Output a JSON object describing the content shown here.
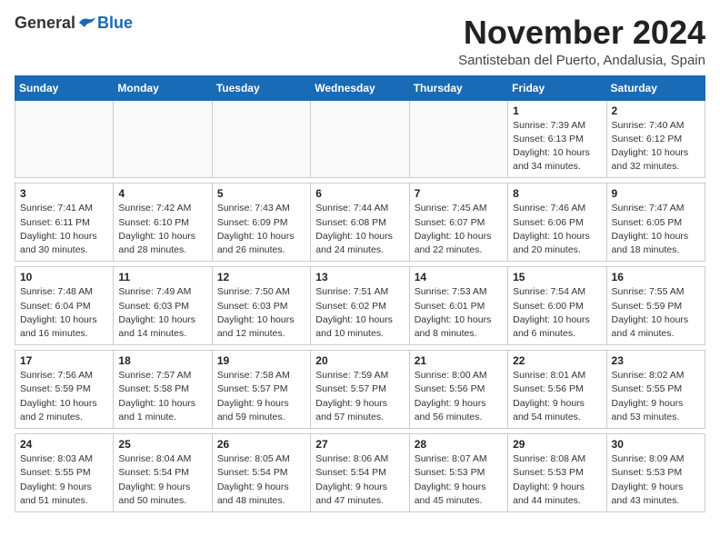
{
  "header": {
    "logo_general": "General",
    "logo_blue": "Blue",
    "month_title": "November 2024",
    "location": "Santisteban del Puerto, Andalusia, Spain"
  },
  "weekdays": [
    "Sunday",
    "Monday",
    "Tuesday",
    "Wednesday",
    "Thursday",
    "Friday",
    "Saturday"
  ],
  "weeks": [
    [
      {
        "day": "",
        "info": ""
      },
      {
        "day": "",
        "info": ""
      },
      {
        "day": "",
        "info": ""
      },
      {
        "day": "",
        "info": ""
      },
      {
        "day": "",
        "info": ""
      },
      {
        "day": "1",
        "info": "Sunrise: 7:39 AM\nSunset: 6:13 PM\nDaylight: 10 hours\nand 34 minutes."
      },
      {
        "day": "2",
        "info": "Sunrise: 7:40 AM\nSunset: 6:12 PM\nDaylight: 10 hours\nand 32 minutes."
      }
    ],
    [
      {
        "day": "3",
        "info": "Sunrise: 7:41 AM\nSunset: 6:11 PM\nDaylight: 10 hours\nand 30 minutes."
      },
      {
        "day": "4",
        "info": "Sunrise: 7:42 AM\nSunset: 6:10 PM\nDaylight: 10 hours\nand 28 minutes."
      },
      {
        "day": "5",
        "info": "Sunrise: 7:43 AM\nSunset: 6:09 PM\nDaylight: 10 hours\nand 26 minutes."
      },
      {
        "day": "6",
        "info": "Sunrise: 7:44 AM\nSunset: 6:08 PM\nDaylight: 10 hours\nand 24 minutes."
      },
      {
        "day": "7",
        "info": "Sunrise: 7:45 AM\nSunset: 6:07 PM\nDaylight: 10 hours\nand 22 minutes."
      },
      {
        "day": "8",
        "info": "Sunrise: 7:46 AM\nSunset: 6:06 PM\nDaylight: 10 hours\nand 20 minutes."
      },
      {
        "day": "9",
        "info": "Sunrise: 7:47 AM\nSunset: 6:05 PM\nDaylight: 10 hours\nand 18 minutes."
      }
    ],
    [
      {
        "day": "10",
        "info": "Sunrise: 7:48 AM\nSunset: 6:04 PM\nDaylight: 10 hours\nand 16 minutes."
      },
      {
        "day": "11",
        "info": "Sunrise: 7:49 AM\nSunset: 6:03 PM\nDaylight: 10 hours\nand 14 minutes."
      },
      {
        "day": "12",
        "info": "Sunrise: 7:50 AM\nSunset: 6:03 PM\nDaylight: 10 hours\nand 12 minutes."
      },
      {
        "day": "13",
        "info": "Sunrise: 7:51 AM\nSunset: 6:02 PM\nDaylight: 10 hours\nand 10 minutes."
      },
      {
        "day": "14",
        "info": "Sunrise: 7:53 AM\nSunset: 6:01 PM\nDaylight: 10 hours\nand 8 minutes."
      },
      {
        "day": "15",
        "info": "Sunrise: 7:54 AM\nSunset: 6:00 PM\nDaylight: 10 hours\nand 6 minutes."
      },
      {
        "day": "16",
        "info": "Sunrise: 7:55 AM\nSunset: 5:59 PM\nDaylight: 10 hours\nand 4 minutes."
      }
    ],
    [
      {
        "day": "17",
        "info": "Sunrise: 7:56 AM\nSunset: 5:59 PM\nDaylight: 10 hours\nand 2 minutes."
      },
      {
        "day": "18",
        "info": "Sunrise: 7:57 AM\nSunset: 5:58 PM\nDaylight: 10 hours\nand 1 minute."
      },
      {
        "day": "19",
        "info": "Sunrise: 7:58 AM\nSunset: 5:57 PM\nDaylight: 9 hours\nand 59 minutes."
      },
      {
        "day": "20",
        "info": "Sunrise: 7:59 AM\nSunset: 5:57 PM\nDaylight: 9 hours\nand 57 minutes."
      },
      {
        "day": "21",
        "info": "Sunrise: 8:00 AM\nSunset: 5:56 PM\nDaylight: 9 hours\nand 56 minutes."
      },
      {
        "day": "22",
        "info": "Sunrise: 8:01 AM\nSunset: 5:56 PM\nDaylight: 9 hours\nand 54 minutes."
      },
      {
        "day": "23",
        "info": "Sunrise: 8:02 AM\nSunset: 5:55 PM\nDaylight: 9 hours\nand 53 minutes."
      }
    ],
    [
      {
        "day": "24",
        "info": "Sunrise: 8:03 AM\nSunset: 5:55 PM\nDaylight: 9 hours\nand 51 minutes."
      },
      {
        "day": "25",
        "info": "Sunrise: 8:04 AM\nSunset: 5:54 PM\nDaylight: 9 hours\nand 50 minutes."
      },
      {
        "day": "26",
        "info": "Sunrise: 8:05 AM\nSunset: 5:54 PM\nDaylight: 9 hours\nand 48 minutes."
      },
      {
        "day": "27",
        "info": "Sunrise: 8:06 AM\nSunset: 5:54 PM\nDaylight: 9 hours\nand 47 minutes."
      },
      {
        "day": "28",
        "info": "Sunrise: 8:07 AM\nSunset: 5:53 PM\nDaylight: 9 hours\nand 45 minutes."
      },
      {
        "day": "29",
        "info": "Sunrise: 8:08 AM\nSunset: 5:53 PM\nDaylight: 9 hours\nand 44 minutes."
      },
      {
        "day": "30",
        "info": "Sunrise: 8:09 AM\nSunset: 5:53 PM\nDaylight: 9 hours\nand 43 minutes."
      }
    ]
  ]
}
